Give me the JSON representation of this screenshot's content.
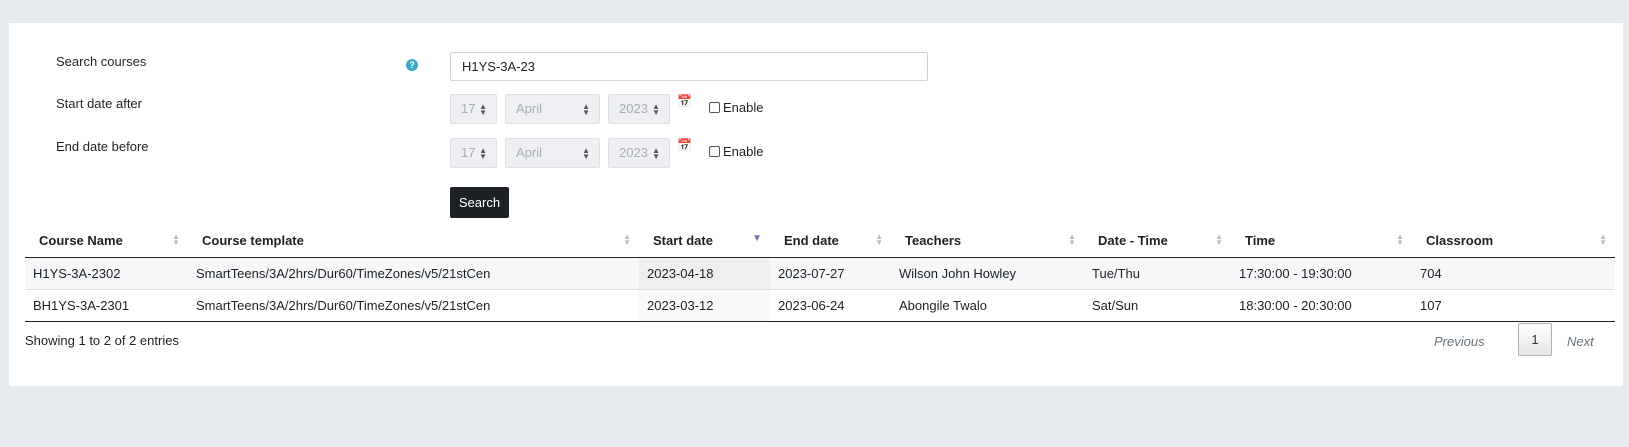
{
  "form": {
    "search_label": "Search courses",
    "search_value": "H1YS-3A-23",
    "start_label": "Start date after",
    "end_label": "End date before",
    "start_date": {
      "day": "17",
      "month": "April",
      "year": "2023",
      "enable_label": "Enable"
    },
    "end_date": {
      "day": "17",
      "month": "April",
      "year": "2023",
      "enable_label": "Enable"
    },
    "search_button": "Search",
    "help_glyph": "?"
  },
  "table": {
    "columns": [
      "Course Name",
      "Course template",
      "Start date",
      "End date",
      "Teachers",
      "Date - Time",
      "Time",
      "Classroom"
    ],
    "rows": [
      [
        "H1YS-3A-2302",
        "SmartTeens/3A/2hrs/Dur60/TimeZones/v5/21stCen",
        "2023-04-18",
        "2023-07-27",
        "Wilson John Howley",
        "Tue/Thu",
        "17:30:00 - 19:30:00",
        "704"
      ],
      [
        "BH1YS-3A-2301",
        "SmartTeens/3A/2hrs/Dur60/TimeZones/v5/21stCen",
        "2023-03-12",
        "2023-06-24",
        "Abongile Twalo",
        "Sat/Sun",
        "18:30:00 - 20:30:00",
        "107"
      ]
    ]
  },
  "footer": {
    "info": "Showing 1 to 2 of 2 entries",
    "previous": "Previous",
    "page": "1",
    "next": "Next"
  }
}
